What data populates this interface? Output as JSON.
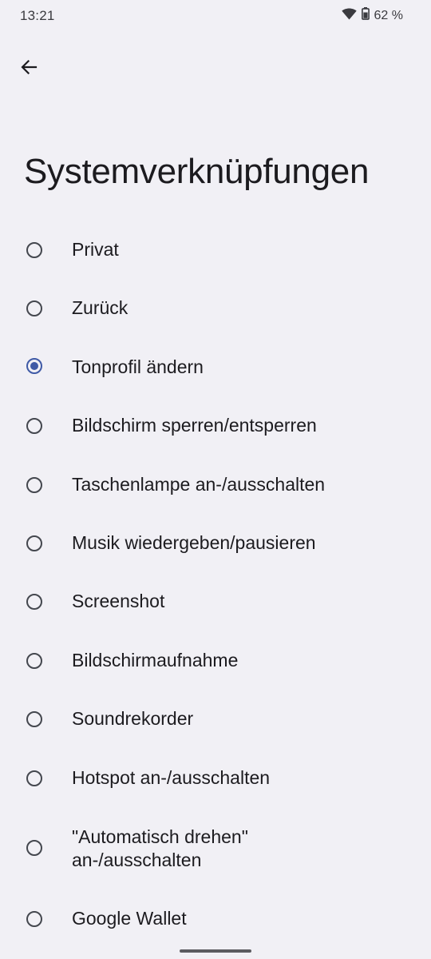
{
  "status_bar": {
    "time": "13:21",
    "battery": "62 %"
  },
  "header": {
    "title": "Systemverknüpfungen"
  },
  "options": [
    {
      "label": "Privat",
      "checked": false
    },
    {
      "label": "Zurück",
      "checked": false
    },
    {
      "label": "Tonprofil ändern",
      "checked": true
    },
    {
      "label": "Bildschirm sperren/entsperren",
      "checked": false
    },
    {
      "label": "Taschenlampe an-/ausschalten",
      "checked": false
    },
    {
      "label": "Musik wiedergeben/pausieren",
      "checked": false
    },
    {
      "label": "Screenshot",
      "checked": false
    },
    {
      "label": "Bildschirmaufnahme",
      "checked": false
    },
    {
      "label": "Soundrekorder",
      "checked": false
    },
    {
      "label": "Hotspot an-/ausschalten",
      "checked": false
    },
    {
      "label": "\"Automatisch drehen\" an-/ausschalten",
      "checked": false
    },
    {
      "label": "Google Wallet",
      "checked": false
    }
  ]
}
